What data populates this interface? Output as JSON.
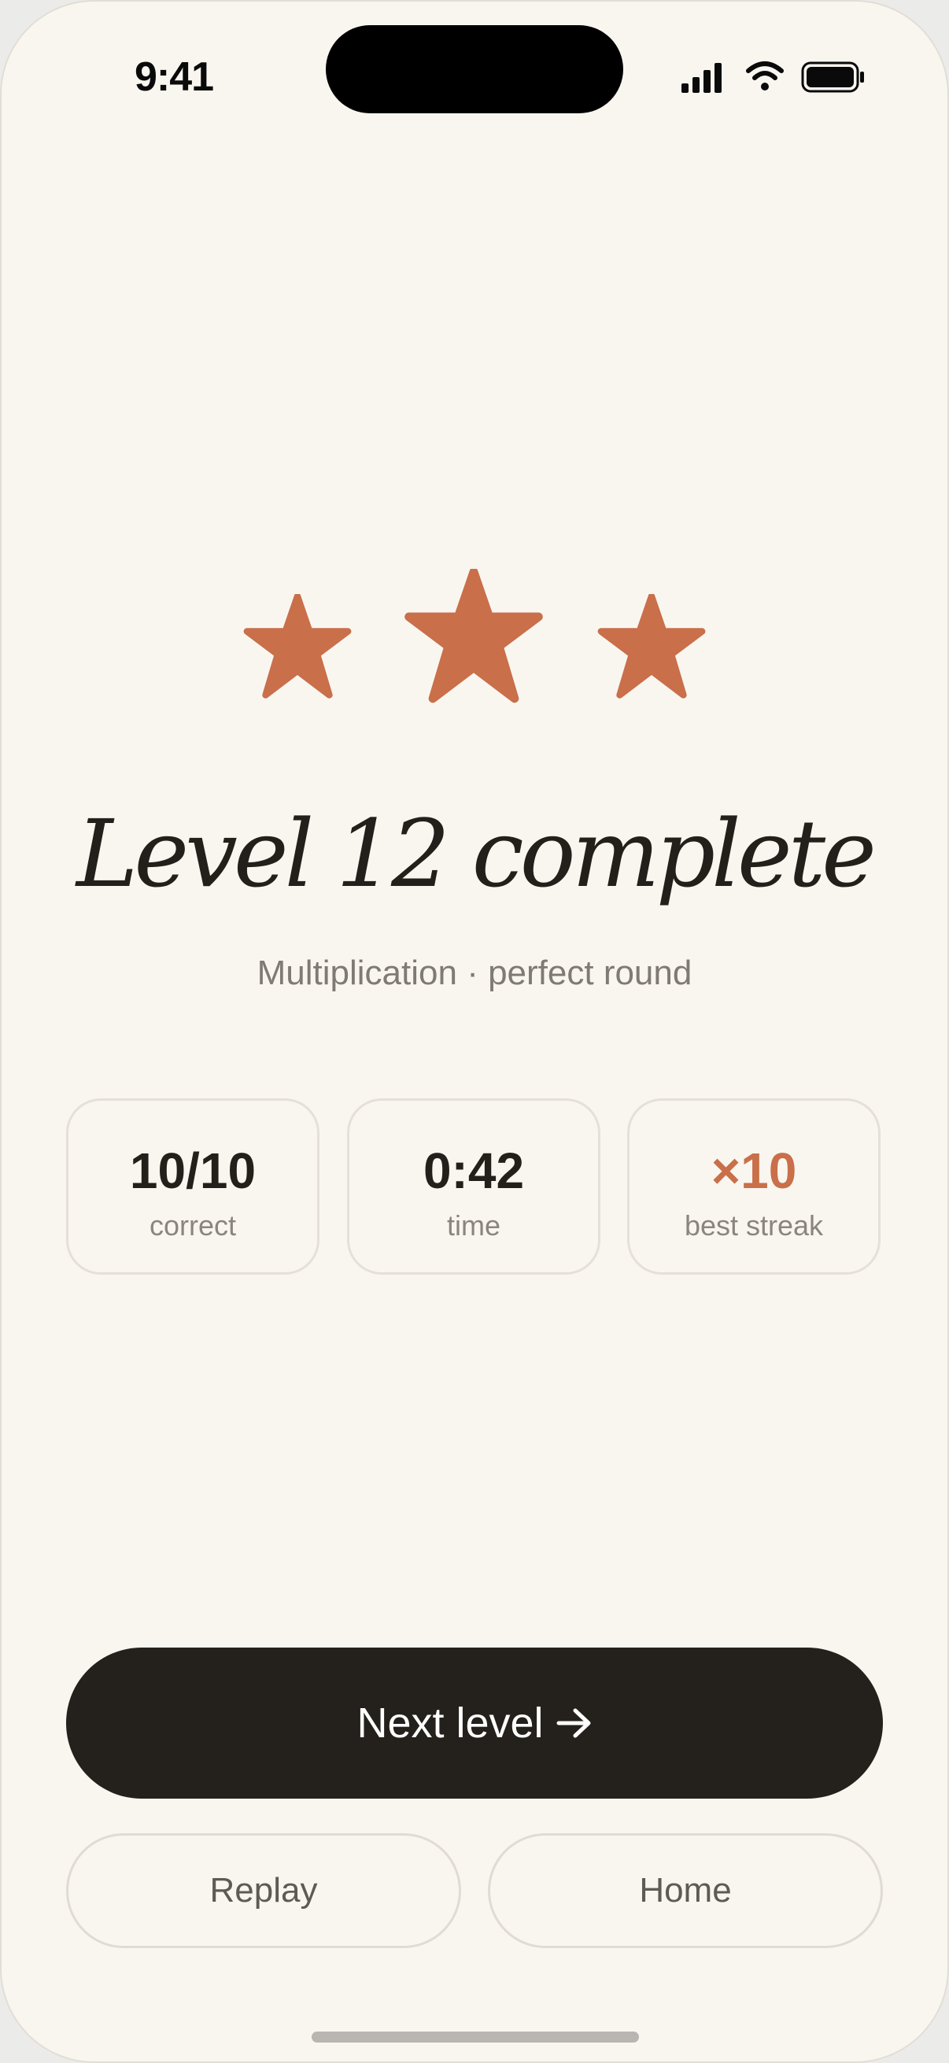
{
  "status_bar": {
    "time": "9:41",
    "icons": [
      "cellular-signal-icon",
      "wifi-icon",
      "battery-icon"
    ]
  },
  "result": {
    "stars_earned": 3,
    "stars_total": 3,
    "title": "Level 12 complete",
    "subtitle": "Multiplication · perfect round"
  },
  "stats": [
    {
      "value": "10/10",
      "label": "correct"
    },
    {
      "value": "0:42",
      "label": "time"
    },
    {
      "value": "×10",
      "label": "best streak"
    }
  ],
  "actions": {
    "next_label": "Next level",
    "replay_label": "Replay",
    "home_label": "Home"
  },
  "colors": {
    "background": "#f9f6f0",
    "accent": "#c96f4a",
    "ink": "#231f1a",
    "muted": "#7f7a73",
    "primary_button": "#24201b"
  }
}
